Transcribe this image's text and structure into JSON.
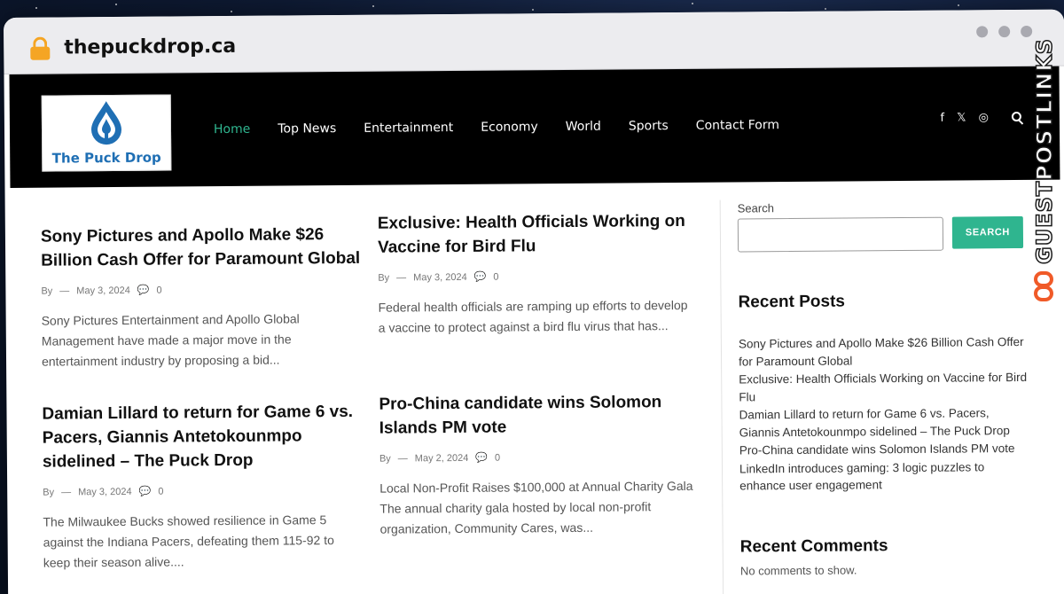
{
  "browser": {
    "url": "thepuckdrop.ca"
  },
  "header": {
    "logo_text": "The Puck Drop",
    "nav": [
      "Home",
      "Top News",
      "Entertainment",
      "Economy",
      "World",
      "Sports",
      "Contact Form"
    ],
    "active_nav": "Home",
    "social_icons": [
      "facebook-icon",
      "x-icon",
      "instagram-icon",
      "search-icon"
    ],
    "social_glyphs": {
      "facebook": "f",
      "x": "𝕏",
      "instagram": "◎"
    }
  },
  "posts": [
    {
      "title": "Sony Pictures and Apollo Make $26 Billion Cash Offer for Paramount Global",
      "by": "By",
      "date": "May 3, 2024",
      "comments": "0",
      "excerpt": "Sony Pictures Entertainment and Apollo Global Management have made a major move in the entertainment industry by proposing a bid..."
    },
    {
      "title": "Exclusive: Health Officials Working on Vaccine for Bird Flu",
      "by": "By",
      "date": "May 3, 2024",
      "comments": "0",
      "excerpt": "Federal health officials are ramping up efforts to develop a vaccine to protect against a bird flu virus that has..."
    },
    {
      "title": "Damian Lillard to return for Game 6 vs. Pacers, Giannis Antetokounmpo sidelined – The Puck Drop",
      "by": "By",
      "date": "May 3, 2024",
      "comments": "0",
      "excerpt": "The Milwaukee Bucks showed resilience in Game 5 against the Indiana Pacers, defeating them 115-92 to keep their season alive...."
    },
    {
      "title": "Pro-China candidate wins Solomon Islands PM vote",
      "by": "By",
      "date": "May 2, 2024",
      "comments": "0",
      "excerpt": "Local Non-Profit Raises $100,000 at Annual Charity Gala The annual charity gala hosted by local non-profit organization, Community Cares, was..."
    }
  ],
  "sidebar": {
    "search_label": "Search",
    "search_button": "SEARCH",
    "search_value": "",
    "recent_posts_title": "Recent Posts",
    "recent_posts": [
      "Sony Pictures and Apollo Make $26 Billion Cash Offer for Paramount Global",
      "Exclusive: Health Officials Working on Vaccine for Bird Flu",
      "Damian Lillard to return for Game 6 vs. Pacers, Giannis Antetokounmpo sidelined – The Puck Drop",
      "Pro-China candidate wins Solomon Islands PM vote",
      "LinkedIn introduces gaming: 3 logic puzzles to enhance user engagement"
    ],
    "recent_comments_title": "Recent Comments",
    "no_comments": "No comments to show."
  },
  "watermark": {
    "text": "GUESTPOSTLINKS"
  },
  "colors": {
    "accent": "#2fb58f",
    "header_bg": "#000000",
    "logo_blue": "#1f6fb4",
    "watermark_orange": "#f05a28"
  }
}
